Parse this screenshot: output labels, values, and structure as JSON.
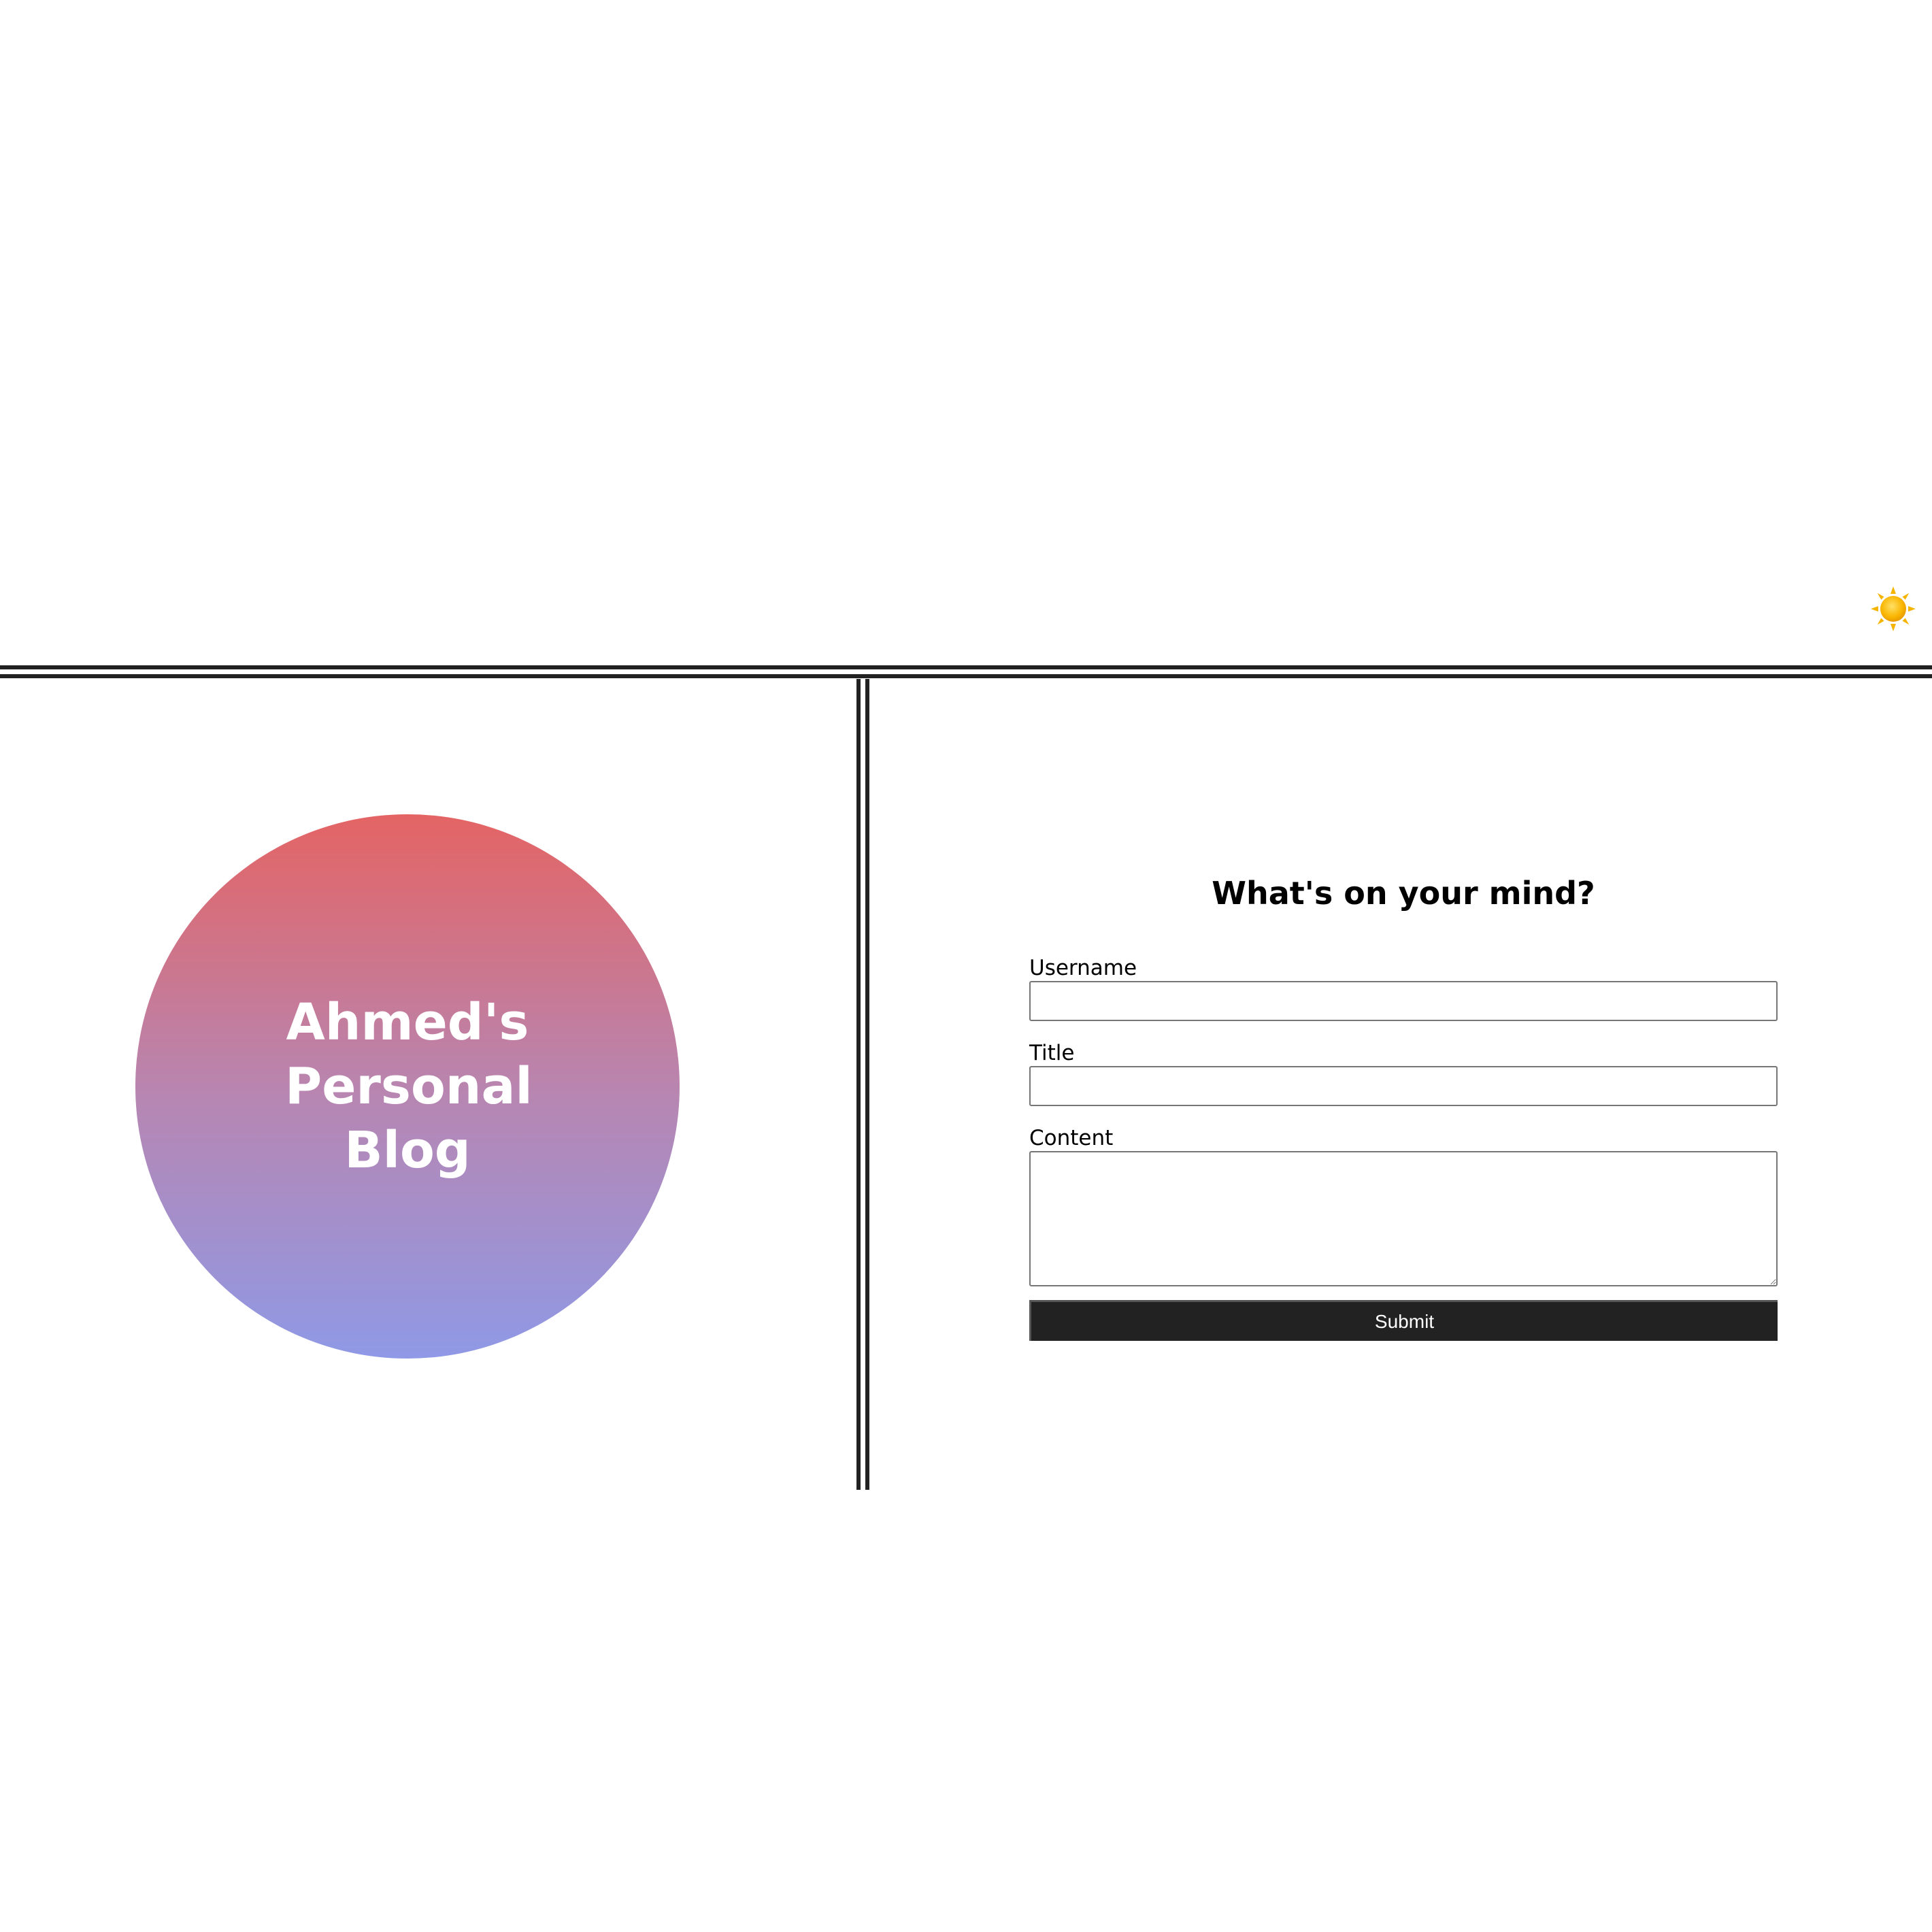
{
  "header": {
    "theme_toggle_icon": "sun-icon",
    "theme_toggle_glyph": "☀"
  },
  "brand": {
    "title": "Ahmed's Personal Blog",
    "gradient_colors": [
      "#e46464",
      "#8f99e6"
    ]
  },
  "post_form": {
    "heading": "What's on your mind?",
    "username_label": "Username",
    "username_value": "",
    "title_label": "Title",
    "title_value": "",
    "content_label": "Content",
    "content_value": "",
    "submit_label": "Submit"
  },
  "colors": {
    "divider": "#222222",
    "button_bg": "#222222",
    "button_text": "#ffffff"
  }
}
